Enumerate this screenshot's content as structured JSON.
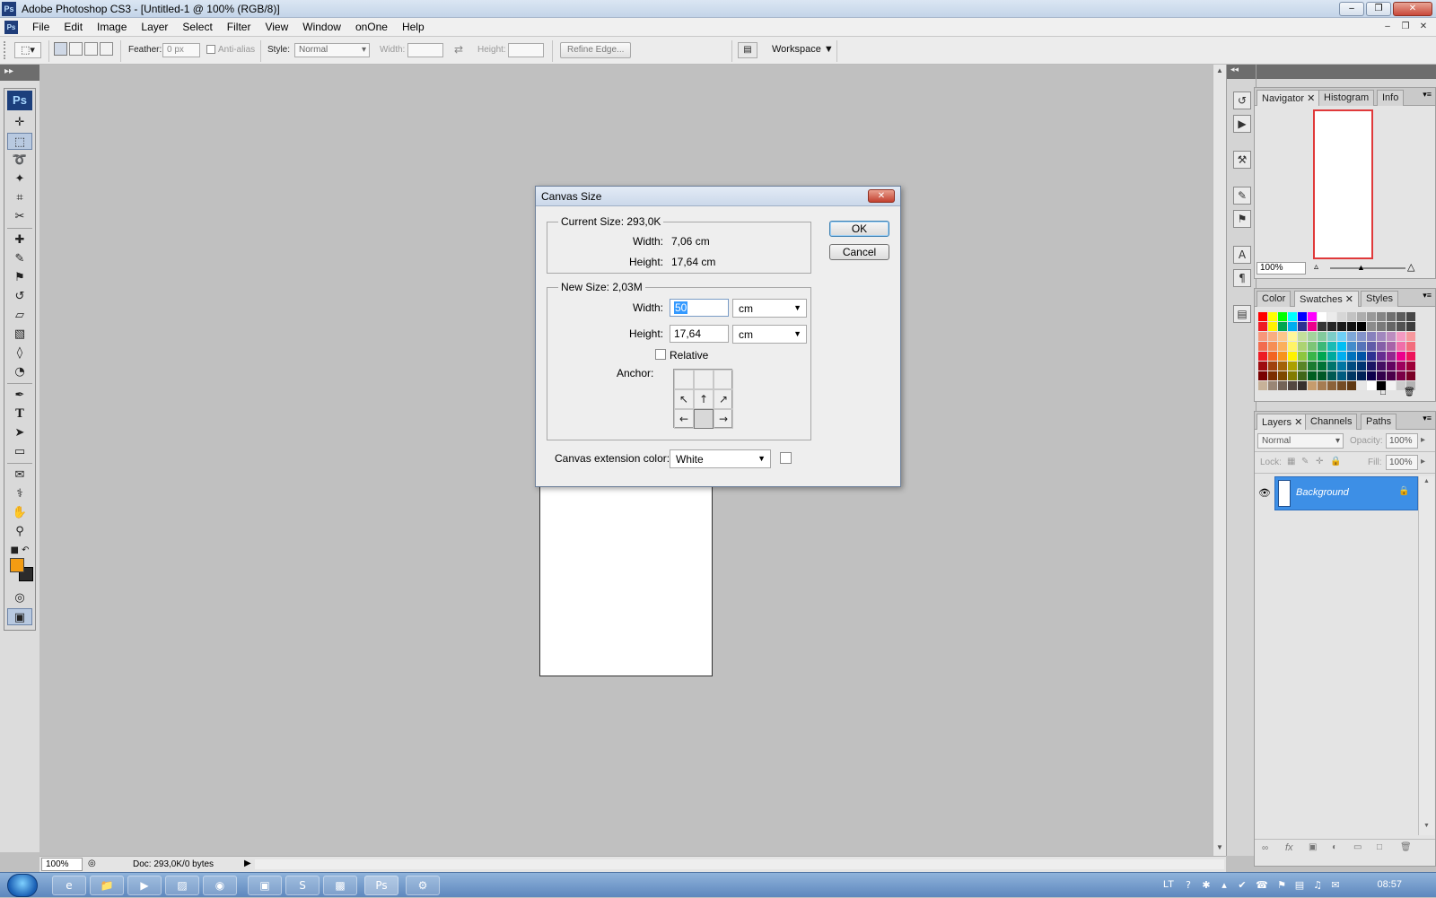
{
  "window": {
    "title": "Adobe Photoshop CS3 - [Untitled-1 @ 100% (RGB/8)]",
    "logo": "Ps",
    "controls": [
      "minimize-icon",
      "restore-icon",
      "close-icon"
    ]
  },
  "menubar": {
    "items": [
      "File",
      "Edit",
      "Image",
      "Layer",
      "Select",
      "Filter",
      "View",
      "Window",
      "onOne",
      "Help"
    ]
  },
  "options": {
    "feather_label": "Feather:",
    "feather_value": "0 px",
    "antialias_label": "Anti-alias",
    "style_label": "Style:",
    "style_value": "Normal",
    "width_label": "Width:",
    "height_label": "Height:",
    "refine_edge": "Refine Edge...",
    "workspace": "Workspace"
  },
  "tools": {
    "logo": "Ps",
    "items": [
      "move-tool",
      "rectangular-marquee-tool",
      "lasso-tool",
      "magic-wand-tool",
      "crop-tool",
      "eyedropper-slice-tool",
      "healing-brush-tool",
      "brush-tool",
      "clone-stamp-tool",
      "history-brush-tool",
      "eraser-tool",
      "gradient-tool",
      "blur-tool",
      "dodge-tool",
      "pen-tool",
      "type-tool",
      "path-selection-tool",
      "rectangle-shape-tool",
      "notes-tool",
      "eyedropper-tool",
      "hand-tool",
      "zoom-tool"
    ],
    "foreground_color": "#f39c12",
    "background_color": "#2b2b2b"
  },
  "dialog": {
    "title": "Canvas Size",
    "current_size_label": "Current Size: 293,0K",
    "current_width_label": "Width:",
    "current_width_value": "7,06 cm",
    "current_height_label": "Height:",
    "current_height_value": "17,64 cm",
    "new_size_label": "New Size: 2,03M",
    "new_width_label": "Width:",
    "new_width_value": "50",
    "new_width_unit": "cm",
    "new_height_label": "Height:",
    "new_height_value": "17,64",
    "new_height_unit": "cm",
    "relative_label": "Relative",
    "relative_checked": false,
    "anchor_label": "Anchor:",
    "extension_label": "Canvas extension color:",
    "extension_value": "White",
    "ok": "OK",
    "cancel": "Cancel"
  },
  "status": {
    "zoom": "100%",
    "doc": "Doc: 293,0K/0 bytes"
  },
  "navigator": {
    "tabs": [
      "Navigator",
      "Histogram",
      "Info"
    ],
    "zoom": "100%"
  },
  "swatches": {
    "tabs": [
      "Color",
      "Swatches",
      "Styles"
    ]
  },
  "layers": {
    "tabs": [
      "Layers",
      "Channels",
      "Paths"
    ],
    "blend_mode": "Normal",
    "opacity_label": "Opacity:",
    "opacity_value": "100%",
    "lock_label": "Lock:",
    "fill_label": "Fill:",
    "fill_value": "100%",
    "layer_name": "Background"
  },
  "taskbar": {
    "language": "LT",
    "clock": "08:57",
    "apps": [
      "internet-explorer-icon",
      "folder-icon",
      "media-player-icon",
      "paint-icon",
      "firefox-icon",
      "image-viewer-icon",
      "skype-icon",
      "photo-icon",
      "photoshop-icon",
      "settings-icon"
    ]
  },
  "colors": {
    "accent_selection": "#3399ff",
    "layer_highlight": "#3d8fe6",
    "navigator_frame": "#e0393a"
  }
}
